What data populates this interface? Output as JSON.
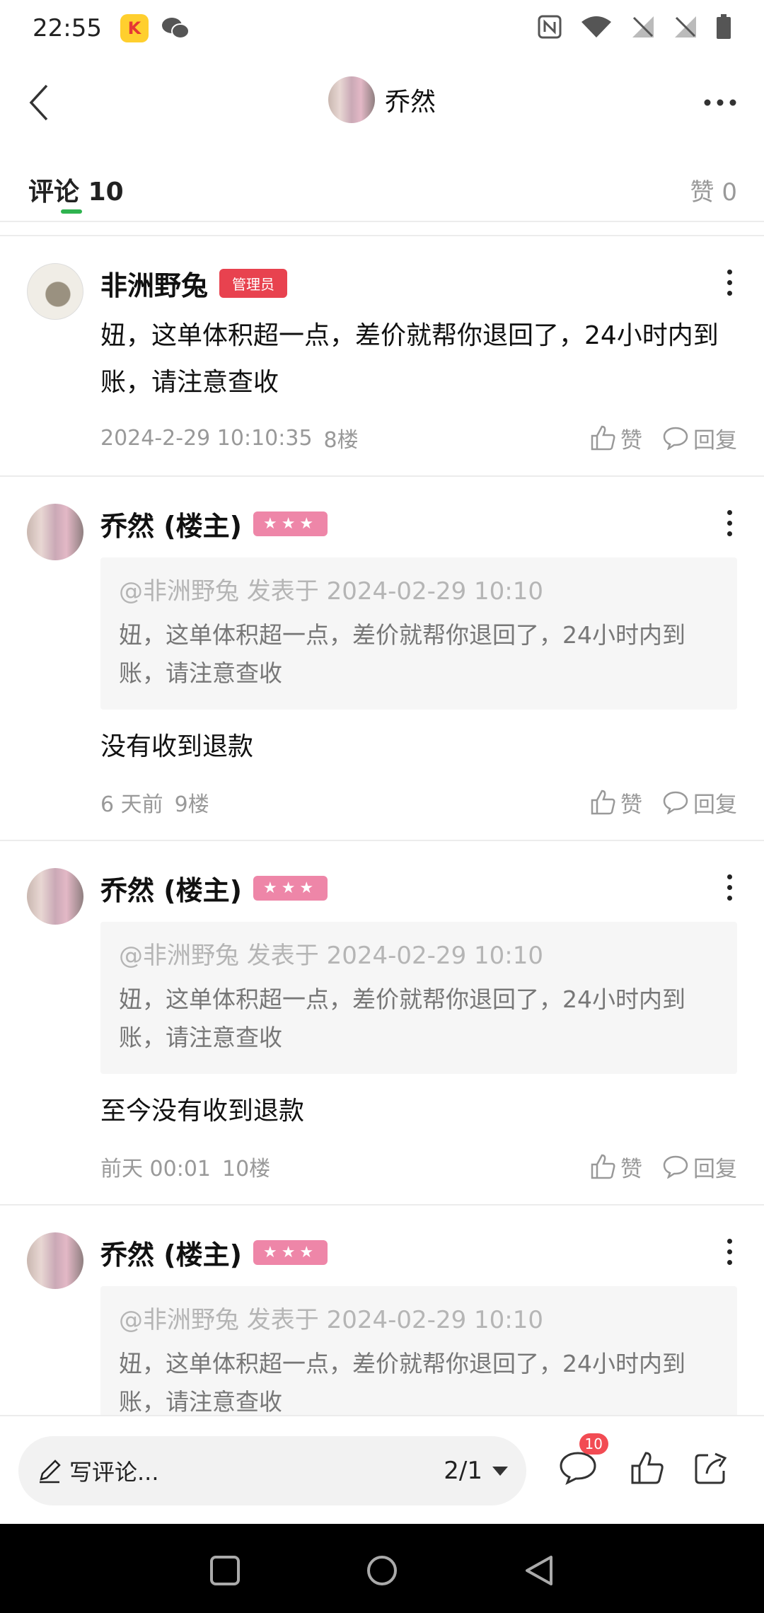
{
  "status_bar": {
    "time": "22:55"
  },
  "header": {
    "title": "乔然"
  },
  "tabs": {
    "comments_label": "评论",
    "comments_count": "10",
    "likes_label": "赞",
    "likes_count": "0"
  },
  "comments": [
    {
      "author": "非洲野兔",
      "badge": "管理员",
      "text": "妞，这单体积超一点，差价就帮你退回了，24小时内到账，请注意查收",
      "time": "2024-2-29 10:10:35",
      "floor": "8楼",
      "like_label": "赞",
      "reply_label": "回复"
    },
    {
      "author": "乔然 (楼主)",
      "badge": "★★★",
      "quote_meta": "@非洲野兔 发表于 2024-02-29 10:10",
      "quote_text": "妞，这单体积超一点，差价就帮你退回了，24小时内到账，请注意查收",
      "text": "没有收到退款",
      "time": "6 天前",
      "floor": "9楼",
      "like_label": "赞",
      "reply_label": "回复"
    },
    {
      "author": "乔然 (楼主)",
      "badge": "★★★",
      "quote_meta": "@非洲野兔 发表于 2024-02-29 10:10",
      "quote_text": "妞，这单体积超一点，差价就帮你退回了，24小时内到账，请注意查收",
      "text": "至今没有收到退款",
      "time": "前天 00:01",
      "floor": "10楼",
      "like_label": "赞",
      "reply_label": "回复"
    },
    {
      "author": "乔然 (楼主)",
      "badge": "★★★",
      "quote_meta": "@非洲野兔 发表于 2024-02-29 10:10",
      "quote_text": "妞，这单体积超一点，差价就帮你退回了，24小时内到账，请注意查收"
    }
  ],
  "bottom_bar": {
    "placeholder": "写评论...",
    "page_indicator": "2/1",
    "comment_count": "10"
  },
  "colors": {
    "accent_green": "#2fb34f",
    "admin_badge": "#e8424f",
    "star_badge": "#ee86a8",
    "count_badge": "#f24b53"
  },
  "icons": [
    "back-icon",
    "more-icon",
    "pencil-icon",
    "comment-icon",
    "like-icon",
    "share-icon",
    "nfc-icon",
    "wifi-icon",
    "battery-icon",
    "wechat-icon"
  ]
}
